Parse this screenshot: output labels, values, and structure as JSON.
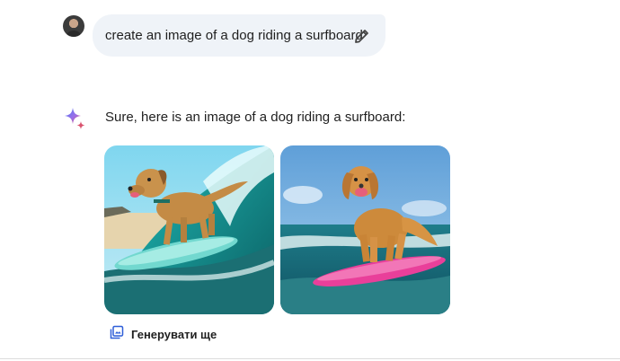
{
  "prompt": {
    "text": "create an image of a dog riding a surfboard",
    "edit_icon": "pencil-icon"
  },
  "response": {
    "assistant_icon": "sparkle-icon",
    "text": "Sure, here is an image of a dog riding a surfboard:",
    "images": [
      {
        "subject": "dog-on-turquoise-surfboard-in-wave"
      },
      {
        "subject": "golden-retriever-on-pink-surfboard"
      }
    ],
    "generate_more": {
      "label": "Генерувати ще",
      "icon": "image-stack-icon"
    }
  },
  "colors": {
    "bubble_bg": "#eff3f8",
    "accent_blue": "#4a78ea",
    "surfboard_pink": "#e93f9a",
    "surfboard_teal": "#5fd0c7"
  }
}
